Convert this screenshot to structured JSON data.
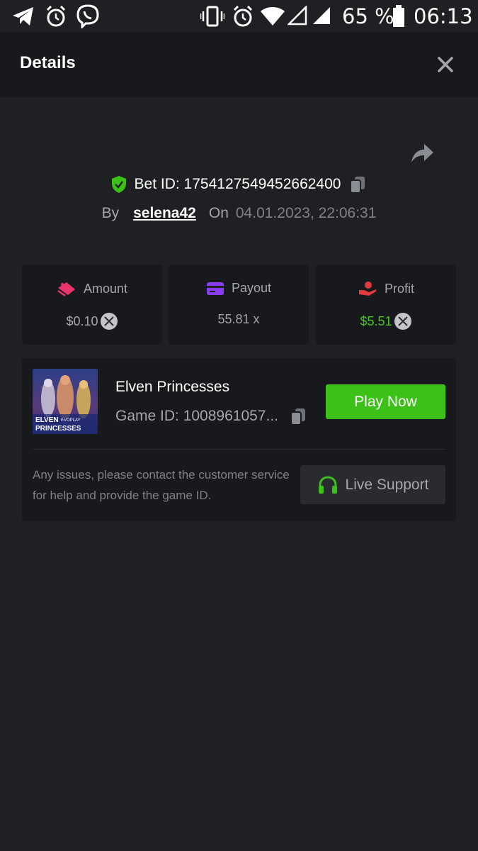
{
  "status_bar": {
    "battery_percent": "65 %",
    "time": "06:13",
    "icons": [
      "telegram-icon",
      "alarm-icon",
      "viber-icon",
      "vibrate-icon",
      "alarm-icon",
      "wifi-icon",
      "signal-empty-icon",
      "signal-icon",
      "battery-icon"
    ]
  },
  "header": {
    "title": "Details",
    "close_icon": "close-icon"
  },
  "bet": {
    "share_icon": "share-icon",
    "verified_icon": "shield-check-icon",
    "bet_id_label": "Bet ID: 1754127549452662400",
    "copy_icon": "copy-icon",
    "by_label": "By",
    "username": "selena42",
    "on_label": "On",
    "datetime": "04.01.2023, 22:06:31"
  },
  "stats": {
    "amount": {
      "label": "Amount",
      "value": "$0.10",
      "icon": "bet-chip-icon",
      "icon_color": "#e8336d"
    },
    "payout": {
      "label": "Payout",
      "value": "55.81 x",
      "icon": "wallet-card-icon",
      "icon_color": "#8a3cf0"
    },
    "profit": {
      "label": "Profit",
      "value": "$5.51",
      "icon": "hand-money-icon",
      "icon_color": "#e03a3a",
      "value_color": "#46c51f"
    }
  },
  "game": {
    "thumbnail_text_line1": "ELVEN",
    "thumbnail_text_brand": "EVOPLAY",
    "thumbnail_text_line2": "PRINCESSES",
    "name": "Elven Princesses",
    "game_id_label": "Game ID: 1008961057...",
    "play_button": "Play Now",
    "help_text": "Any issues, please contact the customer service for help and provide the game ID.",
    "support_button": "Live Support",
    "support_icon": "headset-icon"
  },
  "colors": {
    "background": "#1f2024",
    "card": "#18191c",
    "accent_green": "#3bc117"
  }
}
